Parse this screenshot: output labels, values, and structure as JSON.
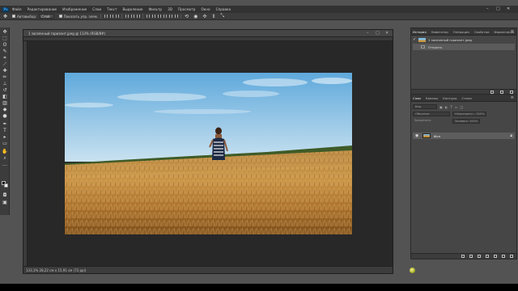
{
  "menubar": {
    "logo": "Ps",
    "items": [
      "Файл",
      "Редактирование",
      "Изображение",
      "Слои",
      "Текст",
      "Выделение",
      "Фильтр",
      "3D",
      "Просмотр",
      "Окно",
      "Справка"
    ],
    "minimize": "–",
    "maximize": "□",
    "close": "✕"
  },
  "options": {
    "autoselect_label": "Автовыбор:",
    "autoselect_value": "Слой",
    "show_transform_label": "Показать упр. элем."
  },
  "document": {
    "title": "1 засеянный горизонт.jpeg @ 133% (RGB/8#)",
    "status": "133,1%   28,22 см x 15,91 см (72 ppi)"
  },
  "history_panel": {
    "tabs": [
      "История",
      "Навигатор",
      "Операции",
      "Свойства",
      "Форматиров"
    ],
    "active_tab": "История",
    "snapshot_label": "1 засеянный горизонт.jpeg",
    "state_label": "Открыть"
  },
  "layers_panel": {
    "tabs": [
      "Слои",
      "Каналы",
      "Контуры",
      "Стили"
    ],
    "active_tab": "Слои",
    "kind_label": "Вид",
    "blend_label": "Обычные",
    "opacity_label": "Непрозрачн.: 100%",
    "lock_label": "Закрепить:",
    "fill_label": "Заливка: 100%",
    "layer_name": "Фон"
  }
}
